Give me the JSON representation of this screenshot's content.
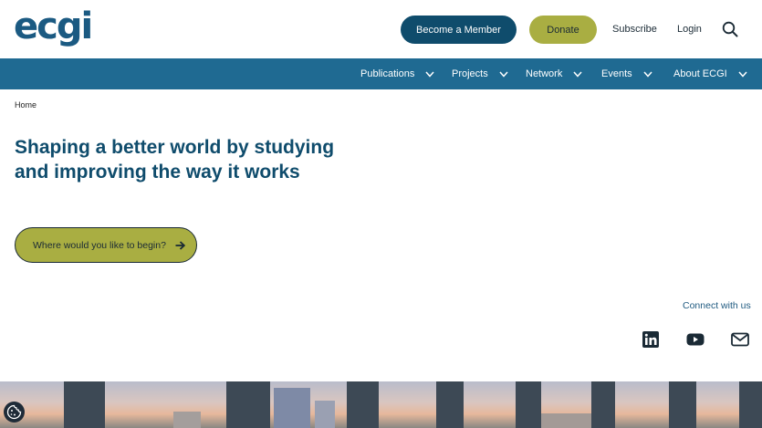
{
  "header": {
    "logo_text": "ecgi",
    "member_label": "Become a Member",
    "donate_label": "Donate",
    "subscribe_label": "Subscribe",
    "login_label": "Login",
    "search_icon": "search-icon"
  },
  "nav": {
    "items": [
      {
        "label": "Publications"
      },
      {
        "label": "Projects"
      },
      {
        "label": "Network"
      },
      {
        "label": "Events"
      },
      {
        "label": "About ECGI"
      }
    ]
  },
  "breadcrumb": "Home",
  "hero": {
    "title": "Shaping a better world by studying and improving the way it works",
    "cta_label": "Where would you like to begin?"
  },
  "connect": {
    "label": "Connect with us",
    "icons": [
      "linkedin-icon",
      "youtube-icon",
      "mail-icon"
    ]
  },
  "colors": {
    "brand_dark": "#0f4c6c",
    "nav_bg": "#1f6a92",
    "accent_olive": "#a9ae42"
  }
}
